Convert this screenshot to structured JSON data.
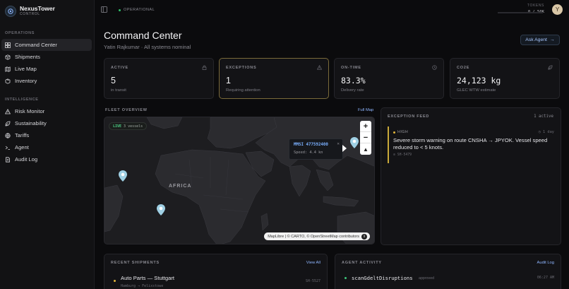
{
  "brand": {
    "title": "NexusTower",
    "subtitle": "CONTROL"
  },
  "sidebar": {
    "sections": [
      {
        "label": "OPERATIONS"
      },
      {
        "label": "INTELLIGENCE"
      }
    ],
    "items": [
      {
        "label": "Command Center",
        "icon": "grid-icon"
      },
      {
        "label": "Shipments",
        "icon": "box-icon"
      },
      {
        "label": "Live Map",
        "icon": "map-icon"
      },
      {
        "label": "Inventory",
        "icon": "package-icon"
      },
      {
        "label": "Risk Monitor",
        "icon": "warning-icon"
      },
      {
        "label": "Sustainability",
        "icon": "leaf-icon"
      },
      {
        "label": "Tariffs",
        "icon": "globe-icon"
      },
      {
        "label": "Agent",
        "icon": "terminal-icon"
      },
      {
        "label": "Audit Log",
        "icon": "document-icon"
      }
    ]
  },
  "topbar": {
    "status": "OPERATIONAL",
    "tokens_label": "TOKENS",
    "tokens_value": "0 / 50K",
    "tokens_fraction": 0,
    "avatar_initial": "Y"
  },
  "header": {
    "title": "Command Center",
    "subtitle": "Yatin Rajkumar · All systems nominal",
    "ask_button": "Ask Agent"
  },
  "kpis": [
    {
      "label": "ACTIVE",
      "value": "5",
      "caption": "in transit",
      "icon": "lock-icon"
    },
    {
      "label": "EXCEPTIONS",
      "value": "1",
      "caption": "Requiring attention",
      "icon": "warning-icon"
    },
    {
      "label": "ON-TIME",
      "value": "83.3%",
      "caption": "Delivery rate",
      "icon": "clock-icon"
    },
    {
      "label": "CO2E",
      "value": "24,123 kg",
      "caption": "GLEC WTW estimate",
      "icon": "leaf-icon"
    }
  ],
  "fleet": {
    "label": "FLEET OVERVIEW",
    "fullmap_link": "Full Map",
    "live_label": "LIVE",
    "vessels_label": "3 vessels",
    "region_label": "AFRICA",
    "popup_title": "MMSI 477592400",
    "popup_speed": "Speed: 4.4 kn",
    "attribution": "MapLibre | © CARTO, © OpenStreetMap contributors"
  },
  "feed": {
    "title": "EXCEPTION FEED",
    "count": "1 active",
    "items": [
      {
        "severity": "HIGH",
        "time": "1 day",
        "message": "Severe storm warning on route CNSHA → JPYOK. Vessel speed reduced to < 5 knots.",
        "id": "SH-5479"
      }
    ]
  },
  "shipments": {
    "title": "RECENT SHIPMENTS",
    "link": "View All",
    "rows": [
      {
        "name": "Auto Parts — Stuttgart",
        "route": "Hamburg → Felixstowe",
        "eta": "SH-5527"
      }
    ]
  },
  "activity": {
    "title": "AGENT ACTIVITY",
    "link": "Audit Log",
    "rows": [
      {
        "name": "scanGdeltDisruptions",
        "status": "approved",
        "time": "06:27 AM"
      }
    ]
  },
  "colors": {
    "accent": "#8fb6ff",
    "warning": "#e0b43a",
    "success": "#2ec26a",
    "background": "#0b0b0d"
  }
}
